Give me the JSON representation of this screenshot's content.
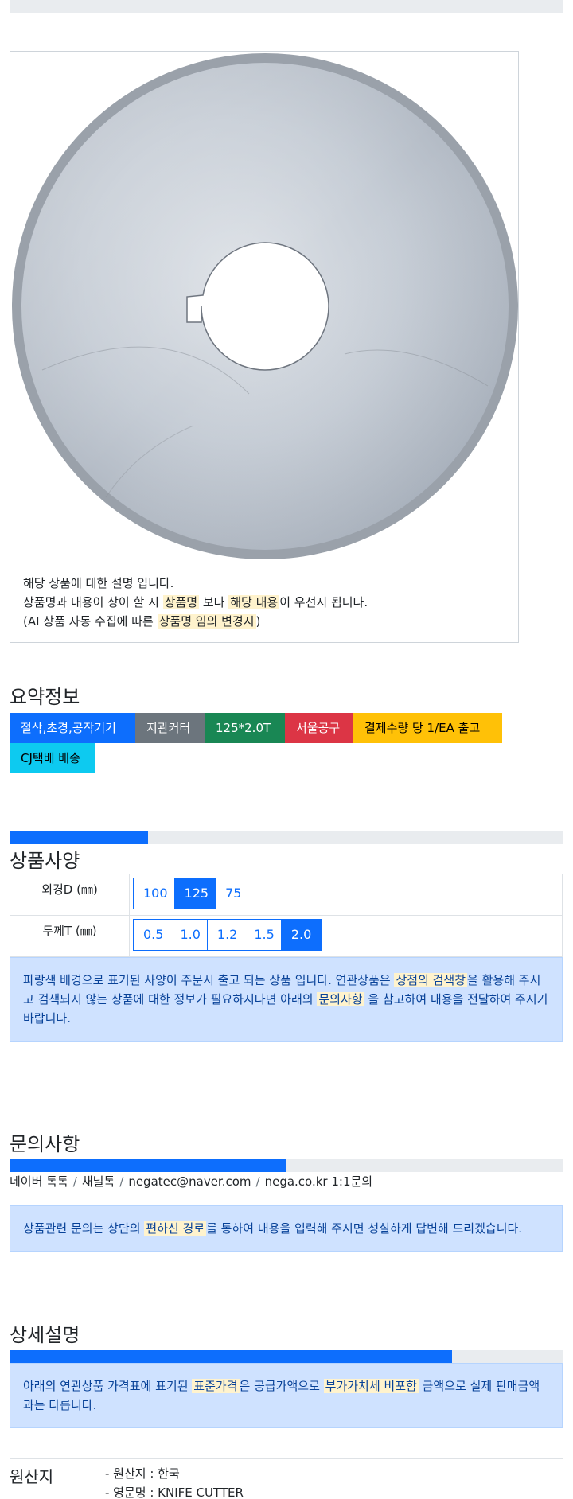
{
  "description": {
    "line1": "해당 상품에 대한 설명 입니다.",
    "line2_pre": "상품명과 내용이 상이 할 시",
    "line2_hl1": "상품명",
    "line2_mid": "보다",
    "line2_hl2": "해당 내용",
    "line2_post": "이 우선시 됩니다.",
    "line3_pre": "(AI 상품 자동 수집에 따른",
    "line3_hl": "상품명 임의 변경시",
    "line3_post": ")"
  },
  "summary": {
    "title": "요약정보",
    "tags": [
      {
        "label": "절삭,초경,공작기기",
        "bg": "#0d6efd",
        "fg": "#ffffff"
      },
      {
        "label": "지관커터",
        "bg": "#6c757d",
        "fg": "#ffffff"
      },
      {
        "label": "125*2.0T",
        "bg": "#198754",
        "fg": "#ffffff"
      },
      {
        "label": "서울공구",
        "bg": "#dc3545",
        "fg": "#ffffff"
      },
      {
        "label": "결제수량 당 1/EA 출고",
        "bg": "#ffc107",
        "fg": "#000000"
      },
      {
        "label": "CJ택배 배송",
        "bg": "#0dcaf0",
        "fg": "#000000"
      }
    ]
  },
  "specs": {
    "title": "상품사양",
    "progress": 0.25,
    "rows": [
      {
        "label": "외경D (㎜)",
        "options": [
          "100",
          "125",
          "75"
        ],
        "selected": "125"
      },
      {
        "label": "두께T (㎜)",
        "options": [
          "0.5",
          "1.0",
          "1.2",
          "1.5",
          "2.0"
        ],
        "selected": "2.0"
      }
    ],
    "notice_pre": "파랑색 배경으로 표기된 사양이 주문시 출고 되는 상품 입니다. 연관상품은",
    "notice_hl1": "상점의 검색창",
    "notice_mid": "을 활용해 주시고 검색되지 않는 상품에 대한 정보가 필요하시다면 아래의",
    "notice_hl2": "문의사항",
    "notice_post": "을 참고하여 내용을 전달하여 주시기 바랍니다."
  },
  "inquiry": {
    "title": "문의사항",
    "progress": 0.5,
    "links": [
      "네이버 톡톡",
      "채널톡",
      "negatec@naver.com",
      "nega.co.kr 1:1문의"
    ],
    "separator": "/",
    "notice_pre": "상품관련 문의는 상단의",
    "notice_hl": "편하신 경로",
    "notice_post": "를 통하여 내용을 입력해 주시면 성실하게 답변해 드리겠습니다."
  },
  "detail": {
    "title": "상세설명",
    "progress": 0.8,
    "notice_pre": "아래의 연관상품 가격표에 표기된",
    "notice_hl1": "표준가격",
    "notice_mid": "은 공급가액으로",
    "notice_hl2": "부가가치세 비포함",
    "notice_post": "금액으로 실제 판매금액과는 다릅니다."
  },
  "origin": {
    "label": "원산지",
    "items": [
      "- 원산지 : 한국",
      "- 영문명 : KNIFE CUTTER"
    ]
  }
}
